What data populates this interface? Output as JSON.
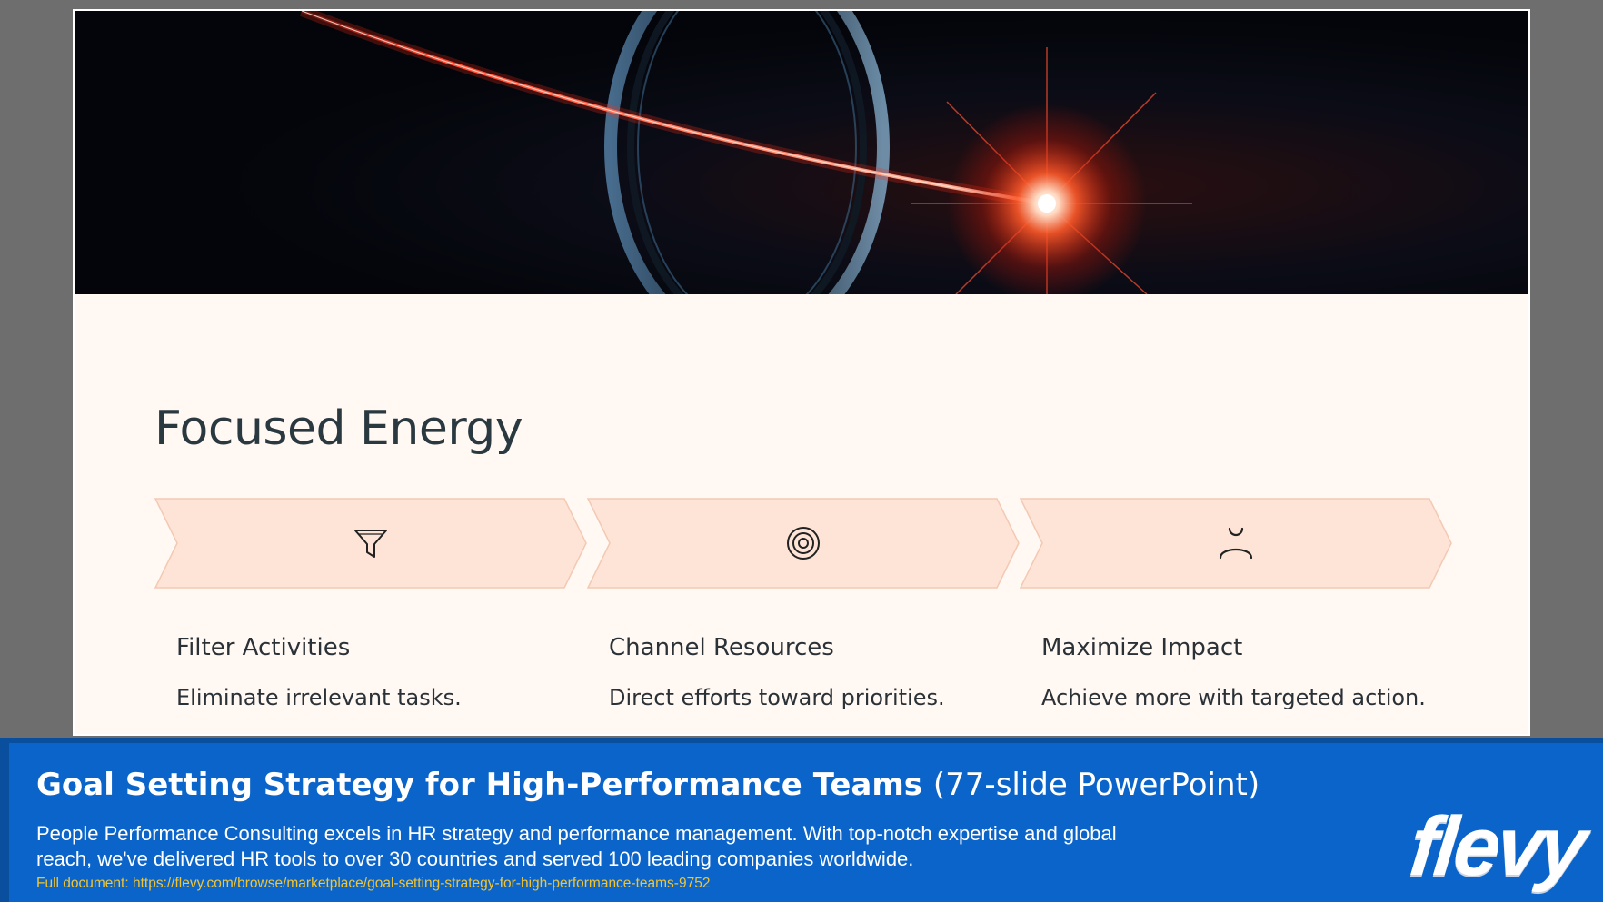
{
  "slide": {
    "title": "Focused Energy",
    "steps": [
      {
        "icon": "funnel-icon",
        "title": "Filter Activities",
        "description": "Eliminate irrelevant tasks."
      },
      {
        "icon": "target-icon",
        "title": "Channel Resources",
        "description": "Direct efforts toward priorities."
      },
      {
        "icon": "person-icon",
        "title": "Maximize Impact",
        "description": "Achieve more with targeted action."
      }
    ]
  },
  "banner": {
    "title": "Goal Setting Strategy for High-Performance Teams",
    "title_suffix": "(77-slide PowerPoint)",
    "description": "People Performance Consulting excels in HR strategy and performance management. With top-notch expertise and global reach, we've delivered HR tools to over 30 countries and served 100 leading companies worldwide.",
    "link": "Full document: https://flevy.com/browse/marketplace/goal-setting-strategy-for-high-performance-teams-9752",
    "logo": "flevy"
  },
  "colors": {
    "page_background": "#6e6e6e",
    "slide_background": "#fff8f3",
    "chevron_fill": "#fde4d6",
    "chevron_stroke": "#f3c9b3",
    "banner_background": "#0a64c9",
    "link_color": "#f3c431",
    "title_color": "#2a3840"
  }
}
